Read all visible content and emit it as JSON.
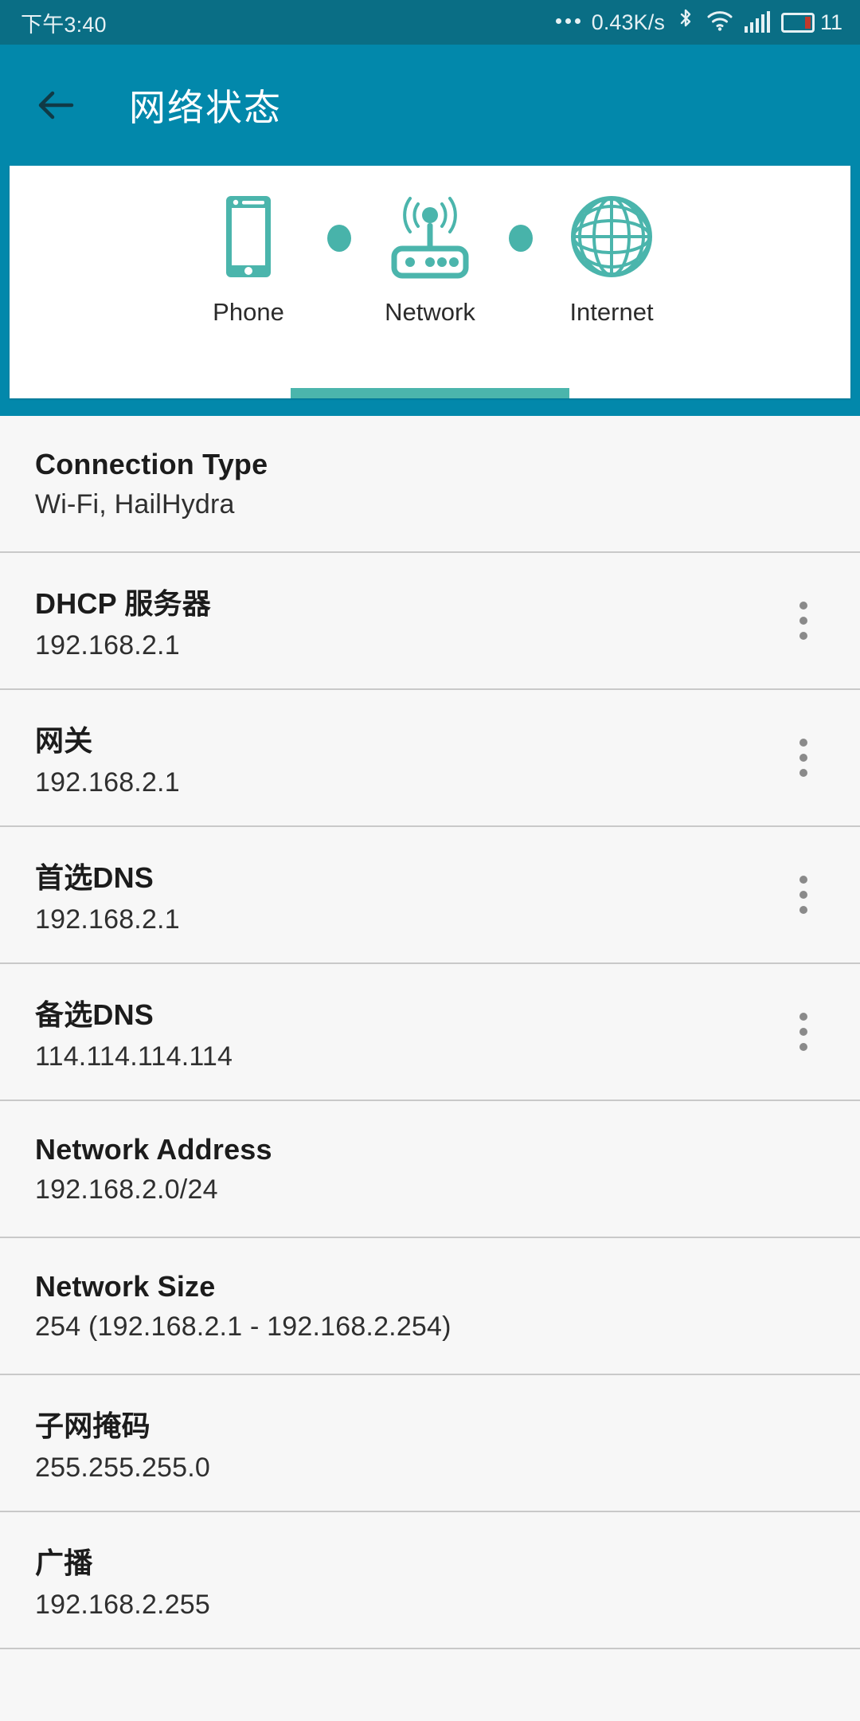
{
  "status_bar": {
    "time": "下午3:40",
    "ellipsis_icon": "more-dots-icon",
    "net_speed": "0.43K/s",
    "bluetooth_icon": "bluetooth-icon",
    "wifi_icon": "wifi-icon",
    "signal_icon": "cellular-signal-icon",
    "battery_icon": "battery-icon",
    "battery_percent": "11"
  },
  "app_bar": {
    "back_icon": "back-arrow-icon",
    "title": "网络状态"
  },
  "diagram": {
    "nodes": [
      {
        "label": "Phone",
        "icon": "phone-icon",
        "selected": false
      },
      {
        "label": "Network",
        "icon": "router-icon",
        "selected": true
      },
      {
        "label": "Internet",
        "icon": "globe-icon",
        "selected": false
      }
    ]
  },
  "colors": {
    "status_bar_bg": "#0a6e85",
    "app_bar_bg": "#0288ab",
    "accent_teal": "#4bb5ac",
    "list_bg": "#f7f7f7",
    "divider": "#c9c9c9",
    "battery_low": "#c0392b"
  },
  "list": {
    "rows": [
      {
        "title": "Connection Type",
        "value": "Wi-Fi, HailHydra",
        "menu": false
      },
      {
        "title": "DHCP 服务器",
        "value": "192.168.2.1",
        "menu": true
      },
      {
        "title": "网关",
        "value": "192.168.2.1",
        "menu": true
      },
      {
        "title": "首选DNS",
        "value": "192.168.2.1",
        "menu": true
      },
      {
        "title": "备选DNS",
        "value": "114.114.114.114",
        "menu": true
      },
      {
        "title": "Network Address",
        "value": "192.168.2.0/24",
        "menu": false
      },
      {
        "title": "Network Size",
        "value": "254 (192.168.2.1 - 192.168.2.254)",
        "menu": false
      },
      {
        "title": "子网掩码",
        "value": "255.255.255.0",
        "menu": false
      },
      {
        "title": "广播",
        "value": "192.168.2.255",
        "menu": false
      }
    ]
  }
}
